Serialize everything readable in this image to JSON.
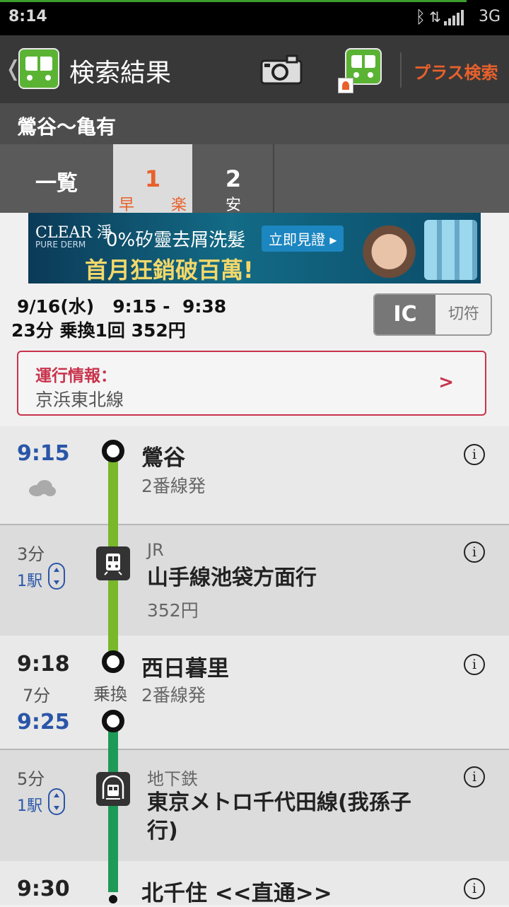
{
  "status_bar": {
    "time": "8:14",
    "network": "3G"
  },
  "action_bar": {
    "title": "検索結果",
    "plus_search": "プラス検索"
  },
  "route": {
    "label": "鶯谷～亀有"
  },
  "tabs": {
    "list": "一覧",
    "tab1": {
      "number": "1",
      "badge_left": "早",
      "badge_right": "楽"
    },
    "tab2": {
      "number": "2",
      "badge": "安"
    }
  },
  "ad": {
    "brand": "CLEAR 淨",
    "brand_sub": "PURE DERM",
    "headline": "0%矽靈去屑洗髮",
    "cta": "立即見證 ▸",
    "sub": "首月狂銷破百萬!"
  },
  "summary": {
    "date_time": "9/16(水)   9:15 -  9:38",
    "stats": "23分 乗換1回 352円",
    "fare_toggle": {
      "ic": "IC",
      "ticket": "切符",
      "selected": "IC"
    }
  },
  "operation_info": {
    "label": "運行情報：",
    "line": "京浜東北線",
    "arrow": ">"
  },
  "timeline": {
    "stop1": {
      "time": "9:15",
      "station": "鶯谷",
      "platform": "2番線発",
      "weather": "cloud-icon"
    },
    "seg1": {
      "minutes": "3分",
      "stops": "1駅",
      "company": "JR",
      "line": "山手線池袋方面行",
      "fare": "352円"
    },
    "stop2": {
      "arrive": "9:18",
      "wait": "7分",
      "depart": "9:25",
      "station": "西日暮里",
      "transfer": "乗換",
      "platform": "2番線発"
    },
    "seg2": {
      "minutes": "5分",
      "stops": "1駅",
      "company": "地下鉄",
      "line": "東京メトロ千代田線(我孫子行)"
    },
    "stop3": {
      "time": "9:30",
      "station": "北千住 <<直通>>"
    }
  },
  "colors": {
    "accent_orange": "#e8612c",
    "time_blue": "#2a56a8",
    "jr_green": "#78b82a",
    "metro_green": "#1e9a58",
    "alert_red": "#c8334c"
  }
}
